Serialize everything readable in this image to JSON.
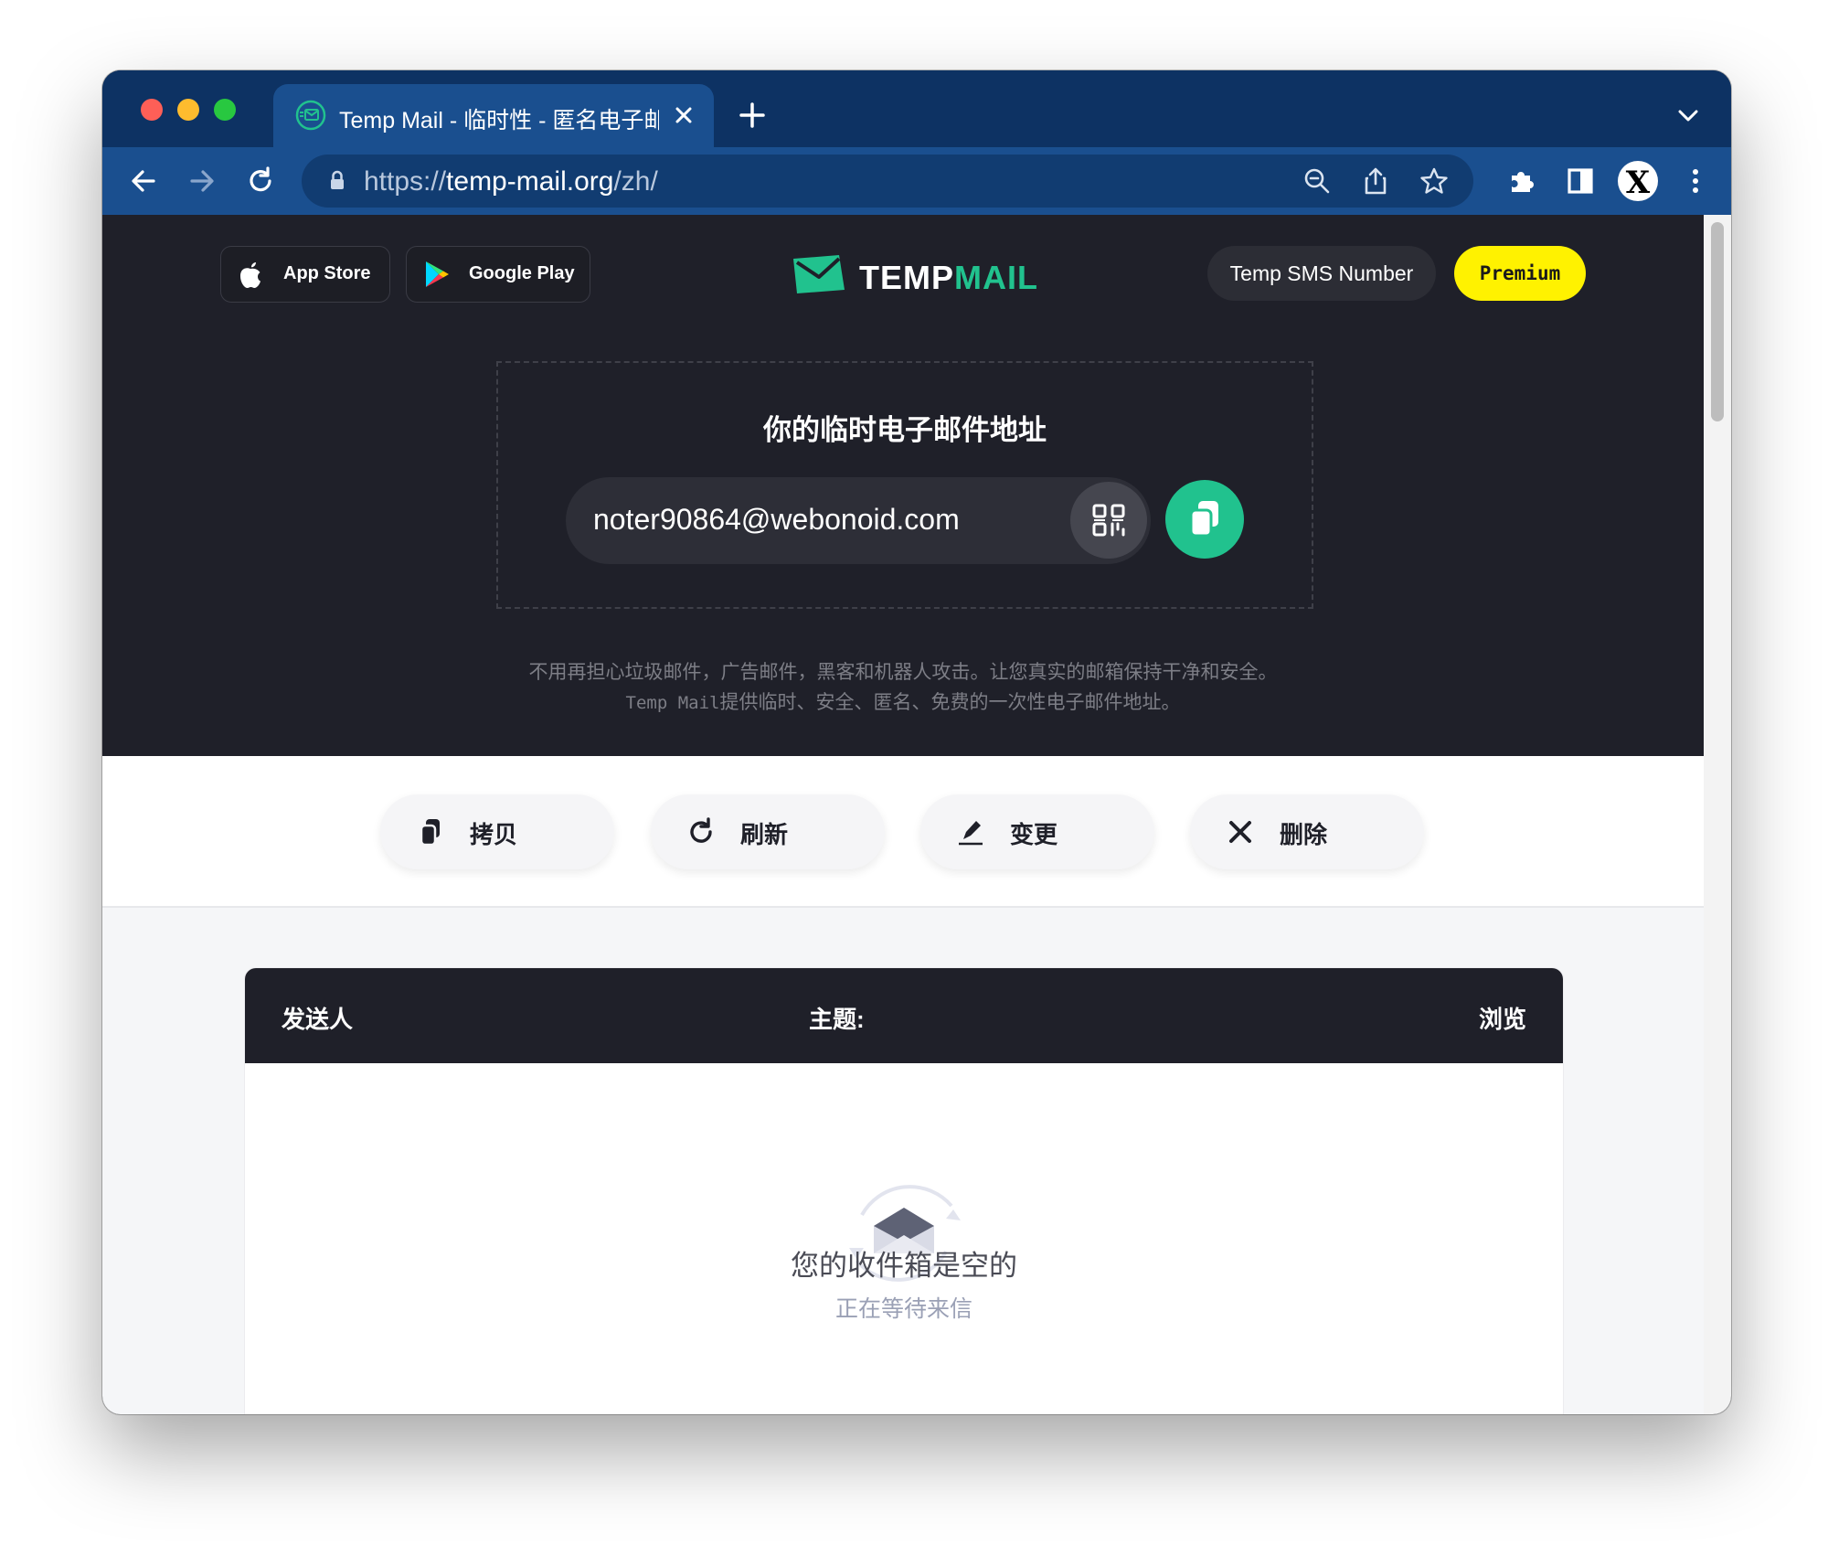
{
  "browser": {
    "tab_title": "Temp Mail - 临时性 - 匿名电子邮",
    "url_scheme": "https://",
    "url_host": "temp-mail.org",
    "url_path": "/zh/",
    "profile_letter": "X"
  },
  "header": {
    "app_store_label": "App Store",
    "google_play_label": "Google Play",
    "logo_part1": "TEMP",
    "logo_part2": "MAIL",
    "sms_label": "Temp SMS Number",
    "premium_label": "Premium"
  },
  "address": {
    "title": "你的临时电子邮件地址",
    "email": "noter90864@webonoid.com"
  },
  "description": {
    "line1": "不用再担心垃圾邮件，广告邮件，黑客和机器人攻击。让您真实的邮箱保持干净和安全。",
    "line2_brand": "Temp Mail",
    "line2_rest": "提供临时、安全、匿名、免费的一次性电子邮件地址。"
  },
  "actions": {
    "copy": "拷贝",
    "refresh": "刷新",
    "change": "变更",
    "delete": "删除"
  },
  "inbox": {
    "col_sender": "发送人",
    "col_subject": "主题:",
    "col_view": "浏览",
    "empty_title": "您的收件箱是空的",
    "empty_sub": "正在等待来信"
  },
  "colors": {
    "accent": "#21c28e",
    "premium": "#fff200",
    "hero_bg": "#1f2029",
    "chrome_tab": "#0d3263",
    "chrome_toolbar": "#1a4f8f"
  }
}
